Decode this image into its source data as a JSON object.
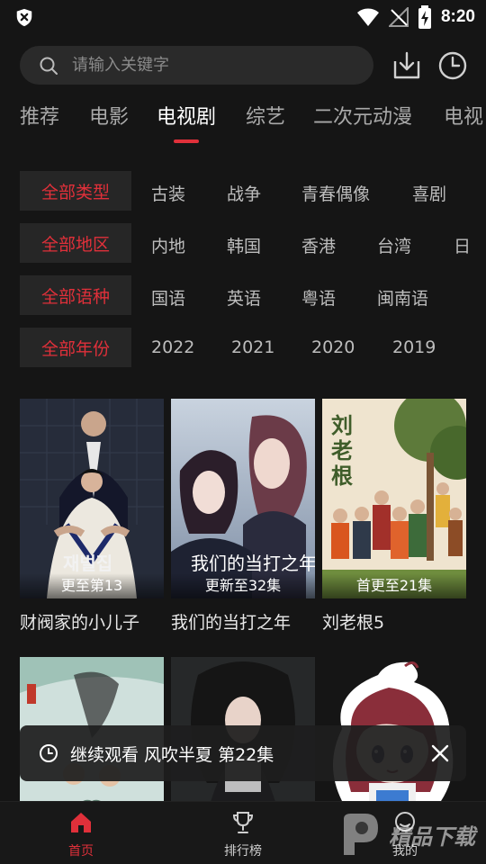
{
  "status_bar": {
    "time": "8:20"
  },
  "search": {
    "placeholder": "请输入关键字"
  },
  "tabs": [
    {
      "label": "推荐"
    },
    {
      "label": "电影"
    },
    {
      "label": "电视剧"
    },
    {
      "label": "综艺"
    },
    {
      "label": "二次元动漫"
    },
    {
      "label": "电视"
    }
  ],
  "active_tab": "电视剧",
  "filters": {
    "type": {
      "selected": "全部类型",
      "options": [
        "古装",
        "战争",
        "青春偶像",
        "喜剧"
      ]
    },
    "region": {
      "selected": "全部地区",
      "options": [
        "内地",
        "韩国",
        "香港",
        "台湾",
        "日"
      ]
    },
    "language": {
      "selected": "全部语种",
      "options": [
        "国语",
        "英语",
        "粤语",
        "闽南语"
      ]
    },
    "year": {
      "selected": "全部年份",
      "options": [
        "2022",
        "2021",
        "2020",
        "2019"
      ]
    }
  },
  "cards": [
    {
      "title": "财阀家的小儿子",
      "badge": "更至第13"
    },
    {
      "title": "我们的当打之年",
      "badge": "更新至32集"
    },
    {
      "title": "刘老根5",
      "badge": "首更至21集"
    },
    {
      "title": "",
      "badge": ""
    },
    {
      "title": "",
      "badge": ""
    }
  ],
  "continue_watching": {
    "text": "继续观看 风吹半夏 第22集"
  },
  "bottom_nav": [
    {
      "label": "首页",
      "active": true
    },
    {
      "label": "排行榜",
      "active": false
    },
    {
      "label": "我的",
      "active": false
    }
  ],
  "watermark": {
    "text": "精品下载"
  },
  "colors": {
    "accent": "#e0303a",
    "background": "#151515",
    "chip": "#262626"
  }
}
